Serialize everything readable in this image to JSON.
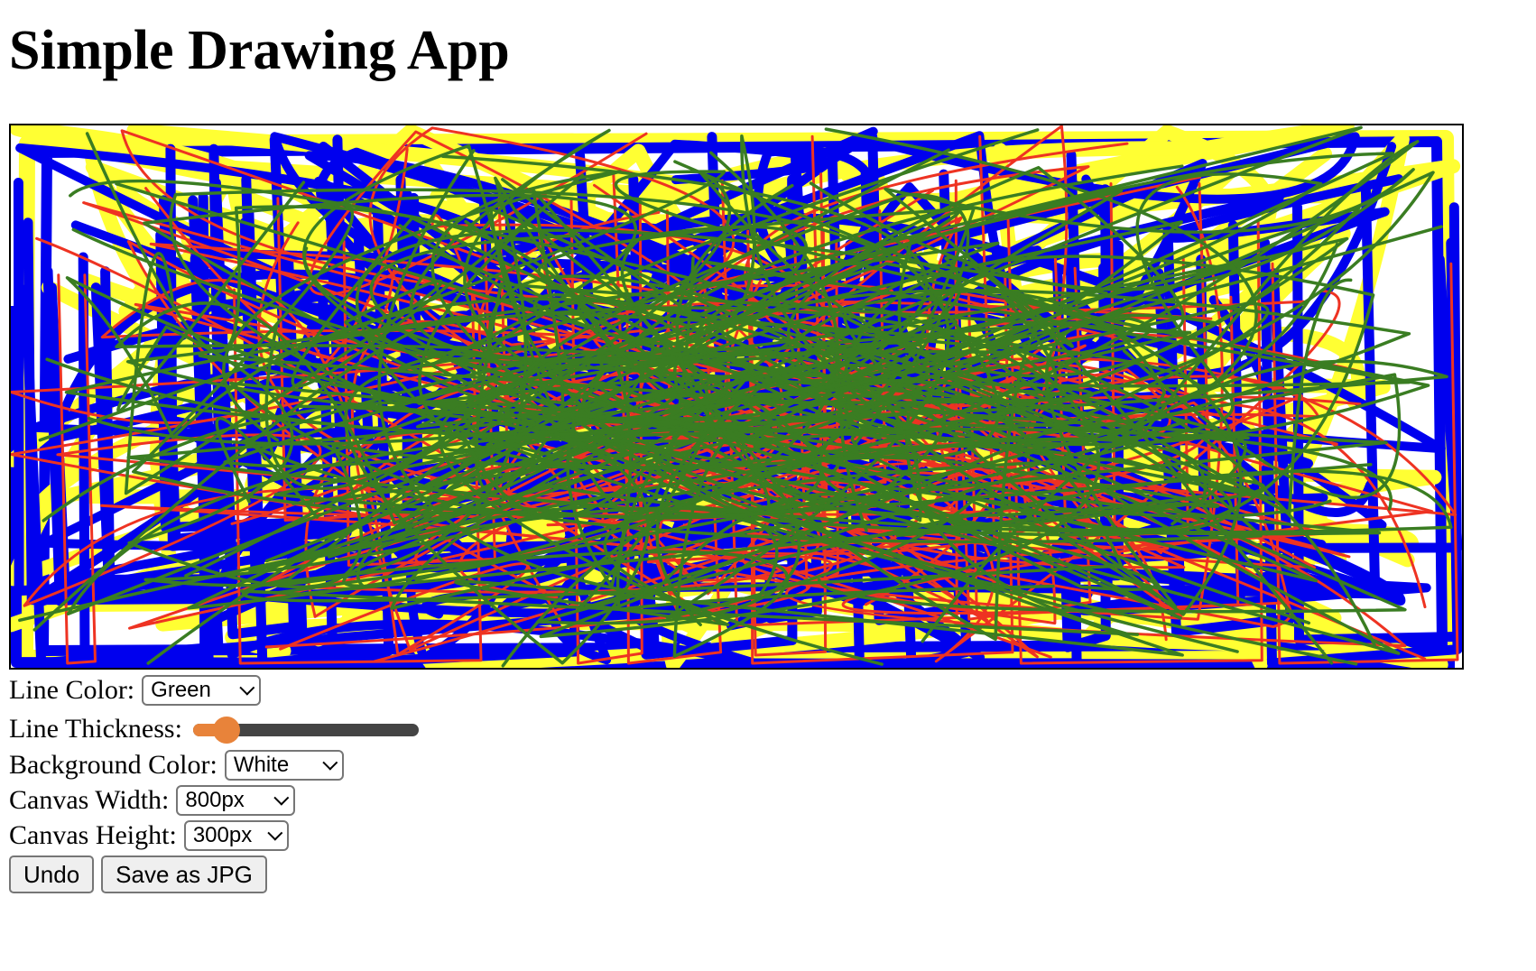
{
  "page": {
    "title": "Simple Drawing App"
  },
  "controls": {
    "line_color": {
      "label": "Line Color:",
      "selected": "Green"
    },
    "line_thickness": {
      "label": "Line Thickness:",
      "value_fraction": 0.15
    },
    "background_color": {
      "label": "Background Color:",
      "selected": "White"
    },
    "canvas_width": {
      "label": "Canvas Width:",
      "selected": "800px"
    },
    "canvas_height": {
      "label": "Canvas Height:",
      "selected": "300px"
    }
  },
  "buttons": {
    "undo": "Undo",
    "save": "Save as JPG"
  },
  "drawing": {
    "stroke_colors": [
      "#ffff33",
      "#0000ee",
      "#ee3322",
      "#3a7d22"
    ],
    "background": "#ffffff"
  },
  "colors": {
    "slider_accent": "#e8833a",
    "slider_track": "#444444"
  }
}
